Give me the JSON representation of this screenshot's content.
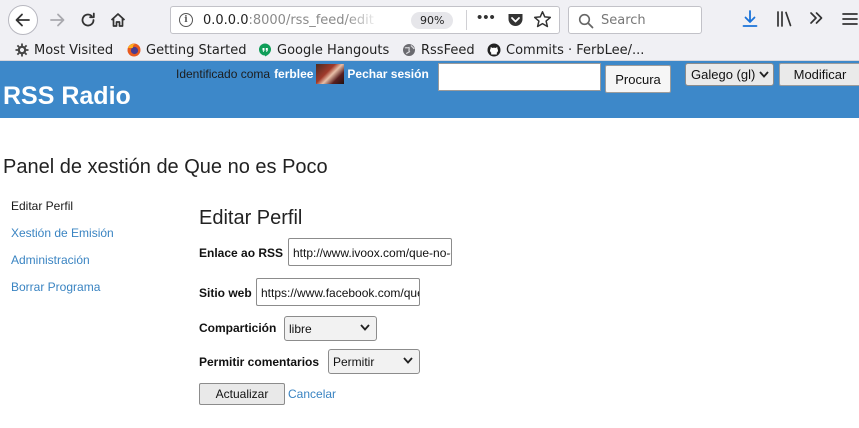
{
  "browser": {
    "url_host": "0.0.0.0",
    "url_path": ":8000/rss_feed/edit",
    "zoom": "90%",
    "search_placeholder": "Search",
    "bookmarks": [
      {
        "label": "Most Visited",
        "icon": "gear-icon"
      },
      {
        "label": "Getting Started",
        "icon": "firefox-icon"
      },
      {
        "label": "Google Hangouts",
        "icon": "hangouts-icon"
      },
      {
        "label": "RssFeed",
        "icon": "globe-icon"
      },
      {
        "label": "Commits · FerbLee/...",
        "icon": "github-icon"
      }
    ]
  },
  "site": {
    "title": "RSS Radio",
    "login_prefix": "Identificado coma",
    "username": "ferblee",
    "logout": "Pechar sesión",
    "search_button": "Procura",
    "language": "Galego (gl)",
    "modify_button": "Modificar",
    "header_color": "#3d88c9",
    "link_color": "#3a84c2"
  },
  "page": {
    "heading": "Panel de xestión de Que no es Poco",
    "sidebar": [
      {
        "label": "Editar Perfil",
        "active": true
      },
      {
        "label": "Xestión de Emisión",
        "active": false
      },
      {
        "label": "Administración",
        "active": false
      },
      {
        "label": "Borrar Programa",
        "active": false
      }
    ]
  },
  "form": {
    "title": "Editar Perfil",
    "rss_label": "Enlace ao RSS",
    "rss_value": "http://www.ivoox.com/que-no-es-poco",
    "web_label": "Sitio web",
    "web_value": "https://www.facebook.com/quenoespoco",
    "share_label": "Compartición",
    "share_value": "libre",
    "comments_label": "Permitir comentarios",
    "comments_value": "Permitir",
    "submit": "Actualizar",
    "cancel": "Cancelar"
  }
}
